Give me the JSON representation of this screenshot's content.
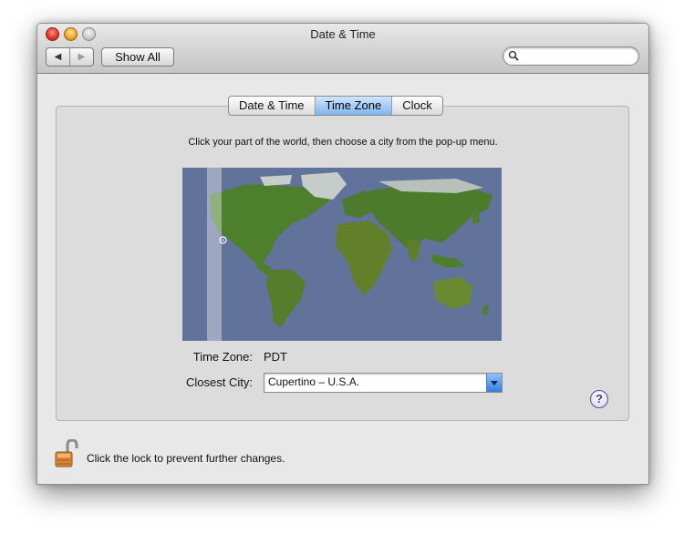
{
  "window": {
    "title": "Date & Time"
  },
  "toolbar": {
    "back_icon": "back-arrow-icon",
    "forward_icon": "forward-arrow-icon",
    "show_all_label": "Show All"
  },
  "search": {
    "placeholder": "",
    "value": ""
  },
  "tabs": [
    {
      "label": "Date & Time",
      "active": false
    },
    {
      "label": "Time Zone",
      "active": true
    },
    {
      "label": "Clock",
      "active": false
    }
  ],
  "time_zone_pane": {
    "instructions": "Click your part of the world, then choose a city from the pop-up menu.",
    "time_zone_label": "Time Zone:",
    "time_zone_value": "PDT",
    "closest_city_label": "Closest City:",
    "closest_city_value": "Cupertino – U.S.A."
  },
  "help": {
    "label": "?"
  },
  "lock": {
    "message": "Click the lock to prevent further changes.",
    "icon": "unlocked-padlock-icon"
  },
  "colors": {
    "map_ocean": "#61739a",
    "land": "#4f7f2e",
    "selection_blue": "#3a8ee6"
  }
}
